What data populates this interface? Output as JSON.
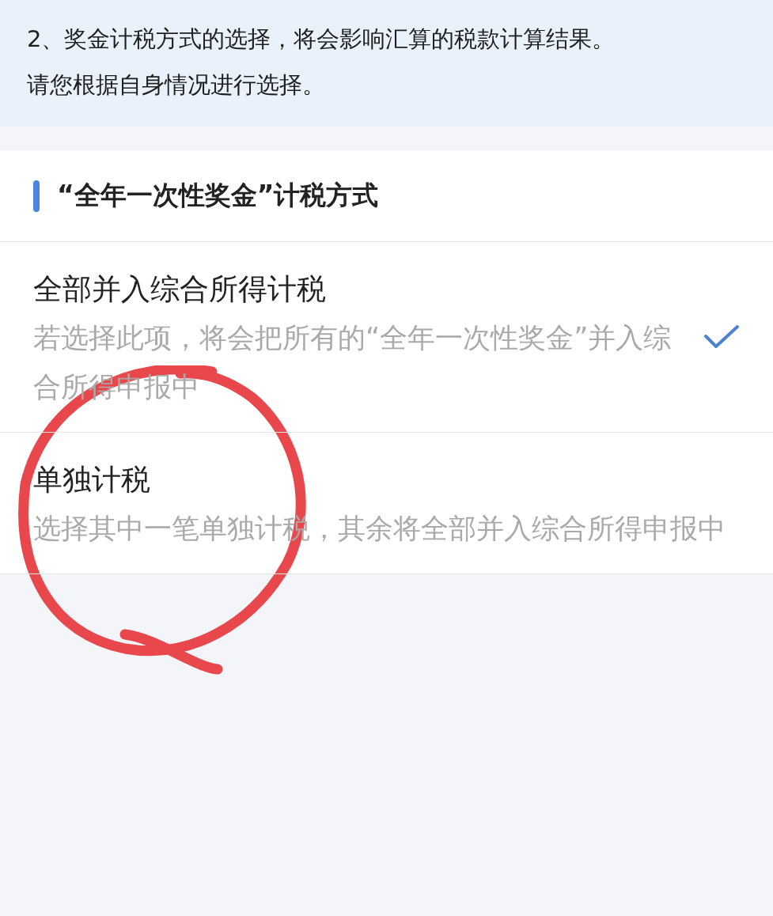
{
  "notice": {
    "lines": [
      "2、奖金计税方式的选择，将会影响汇算的税款计算结果。",
      "请您根据自身情况进行选择。"
    ]
  },
  "section": {
    "title": "“全年一次性奖金”计税方式"
  },
  "options": [
    {
      "title": "全部并入综合所得计税",
      "description": "若选择此项，将会把所有的“全年一次性奖金”并入综合所得申报中",
      "selected": true
    },
    {
      "title": "单独计税",
      "description": "选择其中一笔单独计税，其余将全部并入综合所得申报中",
      "selected": false
    }
  ]
}
